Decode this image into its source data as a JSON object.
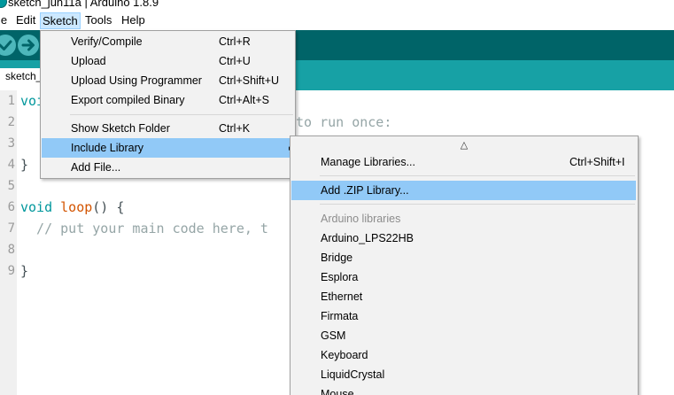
{
  "window": {
    "title": "sketch_jun11a | Arduino 1.8.9",
    "icon": "arduino-icon"
  },
  "menubar": {
    "items": [
      "le",
      "Edit",
      "Sketch",
      "Tools",
      "Help"
    ]
  },
  "toolbar": {
    "verify_icon": "check-icon",
    "upload_icon": "arrow-right-icon"
  },
  "tabs": {
    "active_tab": "sketch_"
  },
  "editor": {
    "line_numbers": [
      "1",
      "2",
      "3",
      "4",
      "5",
      "6",
      "7",
      "8",
      "9"
    ],
    "line1_kw": "voi",
    "line2_comment": "to run once:",
    "line4": "}",
    "line6_kw": "void",
    "line6_fn": "loop",
    "line6_rest": "() {",
    "line7_comment": "  // put your main code here, t",
    "line9": "}"
  },
  "sketch_menu": {
    "items": [
      {
        "label": "Verify/Compile",
        "shortcut": "Ctrl+R"
      },
      {
        "label": "Upload",
        "shortcut": "Ctrl+U"
      },
      {
        "label": "Upload Using Programmer",
        "shortcut": "Ctrl+Shift+U"
      },
      {
        "label": "Export compiled Binary",
        "shortcut": "Ctrl+Alt+S"
      },
      {
        "label": "Show Sketch Folder",
        "shortcut": "Ctrl+K"
      },
      {
        "label": "Include Library",
        "shortcut": ""
      },
      {
        "label": "Add File...",
        "shortcut": ""
      }
    ]
  },
  "library_menu": {
    "scroll_up_glyph": "△",
    "manage": {
      "label": "Manage Libraries...",
      "shortcut": "Ctrl+Shift+I"
    },
    "add_zip": {
      "label": "Add .ZIP Library..."
    },
    "section_header": "Arduino libraries",
    "libraries": [
      "Arduino_LPS22HB",
      "Bridge",
      "Esplora",
      "Ethernet",
      "Firmata",
      "GSM",
      "Keyboard",
      "LiquidCrystal",
      "Mouse"
    ]
  },
  "colors": {
    "toolbar": "#006468",
    "tabstrip": "#17a1a5",
    "highlight": "#91c9f7",
    "keyword": "#00979c",
    "function": "#d35400",
    "comment": "#95a5a6"
  }
}
